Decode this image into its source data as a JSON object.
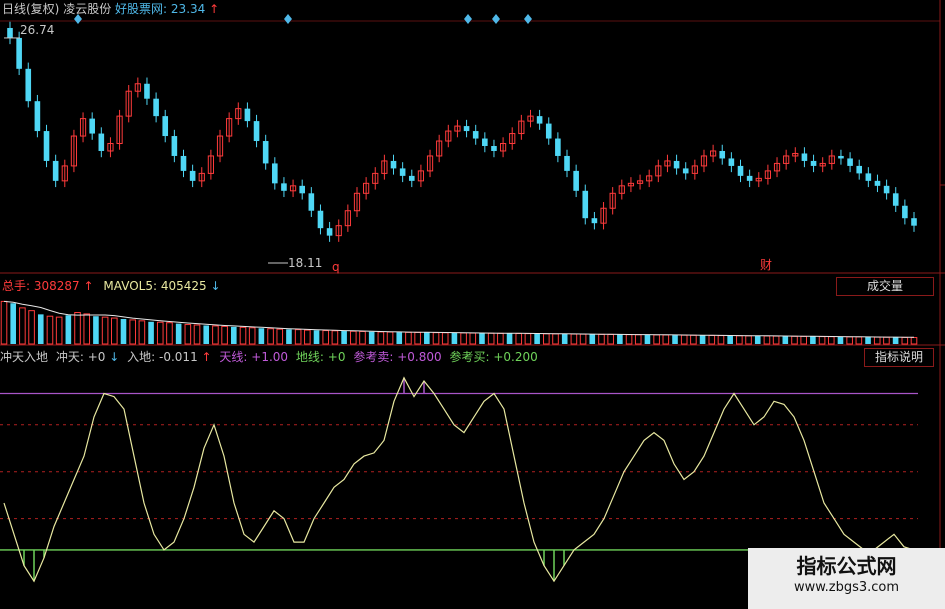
{
  "header": {
    "period": "日线(复权)",
    "stock_name": "凌云股份",
    "site_label": "好股票网:",
    "price": "23.34",
    "price_arrow": "↑"
  },
  "price_panel": {
    "high_label": "26.74",
    "low_label": "18.11",
    "marker_q": "q",
    "marker_cai": "财",
    "ylim": [
      17.5,
      27.3
    ],
    "up_color": "#ff3b3b",
    "down_color": "#4fd7f5",
    "diamond_color": "#4fb8e8"
  },
  "volume_panel": {
    "label": "总手:",
    "value": "308287",
    "value_arrow": "↑",
    "ma_label": "MAVOL5:",
    "ma_value": "405425",
    "ma_arrow": "↓",
    "button": "成交量"
  },
  "indicator_panel": {
    "name": "冲天入地",
    "chongtian_label": "冲天:",
    "chongtian_value": "+0",
    "chongtian_arrow": "↓",
    "rudi_label": "入地:",
    "rudi_value": "-0.011",
    "rudi_arrow": "↑",
    "tianxian_label": "天线:",
    "tianxian_value": "+1.00",
    "dixian_label": "地线:",
    "dixian_value": "+0",
    "sell_label": "参考卖:",
    "sell_value": "+0.800",
    "buy_label": "参考买:",
    "buy_value": "+0.200",
    "button": "指标说明",
    "ylim": [
      -0.32,
      1.15
    ],
    "line_color": "#e8e8a0",
    "sky_color": "#a855c8",
    "ground_color": "#6fd35a",
    "ref_color": "#b02020"
  },
  "watermark": {
    "title": "指标公式网",
    "url": "www.zbgs3.com"
  },
  "chart_data": [
    {
      "type": "line",
      "title": "日线(复权)",
      "series": [
        {
          "name": "凌云股份",
          "values": [
            26.74,
            25.5,
            24.2,
            23.0,
            21.8,
            21.0,
            21.6,
            22.8,
            23.5,
            22.9,
            22.2,
            22.5,
            23.6,
            24.6,
            24.9,
            24.3,
            23.6,
            22.8,
            22.0,
            21.4,
            21.0,
            21.3,
            22.0,
            22.8,
            23.5,
            23.9,
            23.4,
            22.6,
            21.7,
            20.9,
            20.6,
            20.8,
            20.5,
            19.8,
            19.1,
            18.8,
            19.2,
            19.8,
            20.5,
            20.9,
            21.3,
            21.8,
            21.5,
            21.2,
            21.0,
            21.4,
            22.0,
            22.6,
            23.0,
            23.2,
            23.0,
            22.7,
            22.4,
            22.2,
            22.5,
            22.9,
            23.4,
            23.6,
            23.3,
            22.7,
            22.0,
            21.4,
            20.6,
            19.5,
            19.3,
            19.9,
            20.5,
            20.8,
            20.9,
            21.0,
            21.2,
            21.6,
            21.8,
            21.5,
            21.3,
            21.6,
            22.0,
            22.2,
            21.9,
            21.6,
            21.2,
            21.0,
            21.1,
            21.4,
            21.7,
            22.0,
            22.1,
            21.8,
            21.6,
            21.7,
            22.0,
            21.9,
            21.6,
            21.3,
            21.0,
            20.8,
            20.5,
            20.0,
            19.5,
            19.2
          ]
        }
      ],
      "ylim": [
        17.5,
        27.3
      ]
    },
    {
      "type": "bar",
      "title": "成交量",
      "series": [
        {
          "name": "总手",
          "values": [
            920,
            880,
            780,
            720,
            640,
            600,
            580,
            620,
            680,
            650,
            600,
            580,
            560,
            540,
            520,
            500,
            480,
            470,
            460,
            440,
            420,
            410,
            400,
            390,
            380,
            370,
            360,
            350,
            340,
            330,
            320,
            315,
            310,
            300,
            295,
            290,
            285,
            280,
            275,
            270,
            265,
            260,
            258,
            255,
            252,
            250,
            248,
            245,
            243,
            240,
            238,
            236,
            234,
            232,
            230,
            228,
            226,
            224,
            222,
            220,
            218,
            216,
            214,
            212,
            210,
            208,
            206,
            204,
            202,
            200,
            198,
            196,
            194,
            192,
            190,
            188,
            186,
            184,
            182,
            180,
            178,
            176,
            174,
            172,
            170,
            168,
            166,
            164,
            162,
            160,
            158,
            156,
            154,
            152,
            150,
            148,
            146,
            144,
            142,
            140
          ]
        }
      ]
    },
    {
      "type": "line",
      "title": "冲天入地",
      "series": [
        {
          "name": "冲天",
          "values": [
            0.3,
            0.1,
            -0.1,
            -0.2,
            -0.05,
            0.15,
            0.3,
            0.45,
            0.6,
            0.85,
            1.0,
            0.98,
            0.9,
            0.6,
            0.3,
            0.1,
            0.0,
            0.05,
            0.2,
            0.4,
            0.65,
            0.8,
            0.6,
            0.3,
            0.1,
            0.05,
            0.15,
            0.25,
            0.2,
            0.05,
            0.05,
            0.2,
            0.3,
            0.4,
            0.45,
            0.55,
            0.6,
            0.62,
            0.7,
            0.95,
            1.1,
            0.98,
            1.08,
            1.0,
            0.9,
            0.8,
            0.75,
            0.85,
            0.95,
            1.0,
            0.9,
            0.6,
            0.3,
            0.05,
            -0.1,
            -0.2,
            -0.1,
            0.0,
            0.05,
            0.1,
            0.2,
            0.35,
            0.5,
            0.6,
            0.7,
            0.75,
            0.7,
            0.55,
            0.45,
            0.5,
            0.6,
            0.75,
            0.9,
            1.0,
            0.9,
            0.8,
            0.85,
            0.95,
            0.93,
            0.85,
            0.7,
            0.5,
            0.3,
            0.2,
            0.1,
            0.05,
            0.0,
            0.0,
            0.05,
            0.1,
            0.02,
            0.0
          ]
        }
      ],
      "reference_lines": {
        "天线": 1.0,
        "地线": 0,
        "参考卖": 0.8,
        "参考买": 0.2
      },
      "ylim": [
        -0.32,
        1.15
      ]
    }
  ]
}
